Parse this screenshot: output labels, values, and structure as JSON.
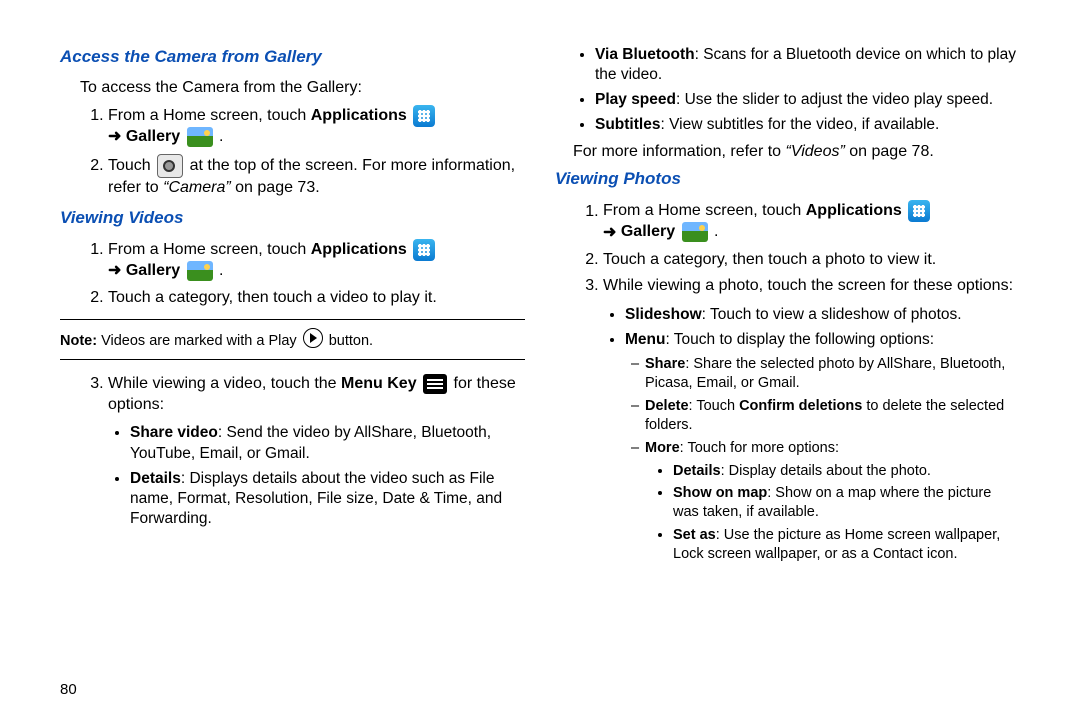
{
  "pageNumber": "80",
  "left": {
    "h1": "Access the Camera from Gallery",
    "intro": "To access the Camera from the Gallery:",
    "step1a": "From a Home screen, touch ",
    "apps": "Applications",
    "gallery": "Gallery",
    "step2a": "Touch ",
    "step2b": " at the top of the screen. For more information, refer to ",
    "cameraRef": "“Camera”",
    "step2c": " on page 73.",
    "h2": "Viewing Videos",
    "vv1a": "From a Home screen, touch ",
    "vv2": "Touch a category, then touch a video to play it.",
    "noteLead": "Note:",
    "noteBody": " Videos are marked with a Play ",
    "noteTail": " button.",
    "vv3a": "While viewing a video, touch the ",
    "menuKey": "Menu Key",
    "vv3b": " for these options:",
    "shareVideoLabel": "Share video",
    "shareVideoText": ": Send the video by AllShare, Bluetooth, YouTube, Email, or Gmail.",
    "detailsLabel": "Details",
    "detailsText": ": Displays details about the video such as File name, Format, Resolution, File size, Date & Time, and Forwarding."
  },
  "right": {
    "btLabel": "Via Bluetooth",
    "btText": ": Scans for a Bluetooth device on which to play the video.",
    "psLabel": "Play speed",
    "psText": ": Use the slider to adjust the video play speed.",
    "subLabel": "Subtitles",
    "subText": ": View subtitles for the video, if available.",
    "moreInfoA": "For more information, refer to ",
    "videosRef": "“Videos”",
    "moreInfoB": " on page 78.",
    "h3": "Viewing Photos",
    "vp1a": "From a Home screen, touch ",
    "apps": "Applications",
    "gallery": "Gallery",
    "vp2": "Touch a category, then touch a photo to view it.",
    "vp3": "While viewing a photo, touch the screen for these options:",
    "slideshowLabel": "Slideshow",
    "slideshowText": ": Touch to view a slideshow of photos.",
    "menuLabel": "Menu",
    "menuText": ": Touch to display the following options:",
    "shareLabel": "Share",
    "shareText": ": Share the selected photo by AllShare, Bluetooth, Picasa, Email, or Gmail.",
    "deleteLabel": "Delete",
    "deleteMid": ": Touch ",
    "confirmDeletions": "Confirm deletions",
    "deleteTail": " to delete the selected folders.",
    "moreLabel": "More",
    "moreText": ": Touch for more options:",
    "dLabel": "Details",
    "dText": ": Display details about the photo.",
    "somLabel": "Show on map",
    "somText": ": Show on a map where the picture was taken, if available.",
    "saLabel": "Set as",
    "saText": ": Use the picture as Home screen wallpaper, Lock screen wallpaper, or as a Contact icon."
  }
}
